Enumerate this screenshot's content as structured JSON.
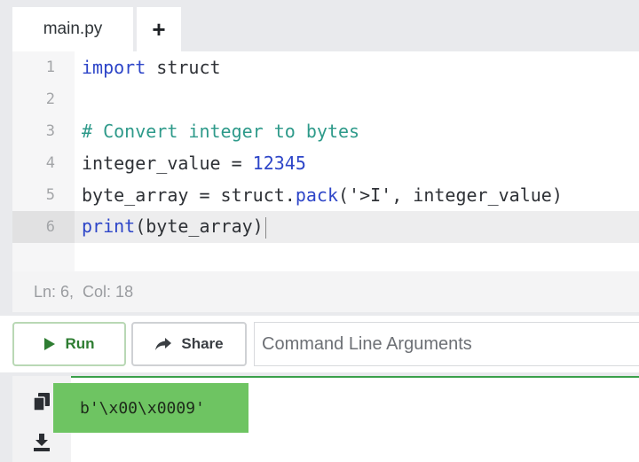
{
  "tabs": [
    {
      "label": "main.py"
    },
    {
      "label": "+"
    }
  ],
  "editor": {
    "lines": [
      {
        "number": "1",
        "tokens": [
          {
            "t": "kw",
            "v": "import"
          },
          {
            "t": "tx",
            "v": " struct"
          }
        ]
      },
      {
        "number": "2",
        "tokens": []
      },
      {
        "number": "3",
        "tokens": [
          {
            "t": "cm",
            "v": "# Convert integer to bytes"
          }
        ]
      },
      {
        "number": "4",
        "tokens": [
          {
            "t": "tx",
            "v": "integer_value = "
          },
          {
            "t": "num",
            "v": "12345"
          }
        ]
      },
      {
        "number": "5",
        "tokens": [
          {
            "t": "tx",
            "v": "byte_array = struct."
          },
          {
            "t": "fn",
            "v": "pack"
          },
          {
            "t": "tx",
            "v": "('>I', integer_value)"
          }
        ]
      },
      {
        "number": "6",
        "tokens": [
          {
            "t": "fn",
            "v": "print"
          },
          {
            "t": "tx",
            "v": "(byte_array)"
          }
        ],
        "active": true
      }
    ]
  },
  "status": {
    "line": "Ln: 6,",
    "col": "Col: 18"
  },
  "toolbar": {
    "run_label": "Run",
    "share_label": "Share",
    "args_placeholder": "Command Line Arguments"
  },
  "output": {
    "text": "b'\\x00\\x0009'"
  },
  "icons": {
    "run": "play-icon",
    "share": "share-arrow-icon",
    "copy": "copy-icon",
    "download": "download-icon"
  },
  "colors": {
    "run_accent": "#2e7d32",
    "output_highlight": "#6ec462",
    "keyword": "#2d45c8",
    "comment": "#2e9a8a"
  }
}
